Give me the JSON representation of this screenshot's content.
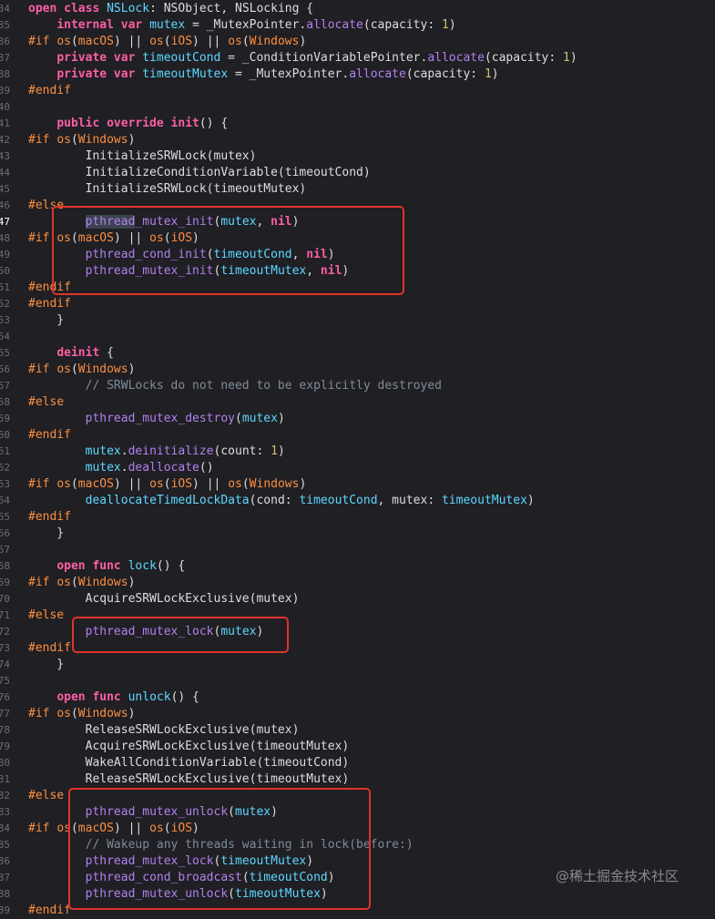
{
  "editor": {
    "lines": [
      {
        "n": "34",
        "segs": [
          [
            "kw",
            "open class "
          ],
          [
            "ty",
            "NSLock"
          ],
          [
            "pl",
            ": "
          ],
          [
            "pl",
            "NSObject"
          ],
          [
            "pl",
            ", "
          ],
          [
            "pl",
            "NSLocking"
          ],
          [
            "pl",
            " {"
          ]
        ]
      },
      {
        "n": "35",
        "segs": [
          [
            "pl",
            "    "
          ],
          [
            "kw",
            "internal var "
          ],
          [
            "ty",
            "mutex"
          ],
          [
            "pl",
            " = _MutexPointer."
          ],
          [
            "fn",
            "allocate"
          ],
          [
            "pl",
            "(capacity: "
          ],
          [
            "nu",
            "1"
          ],
          [
            "pl",
            ")"
          ]
        ]
      },
      {
        "n": "36",
        "segs": [
          [
            "pp",
            "#if "
          ],
          [
            "pp",
            "os"
          ],
          [
            "pl",
            "("
          ],
          [
            "pp",
            "macOS"
          ],
          [
            "pl",
            ") || "
          ],
          [
            "pp",
            "os"
          ],
          [
            "pl",
            "("
          ],
          [
            "pp",
            "iOS"
          ],
          [
            "pl",
            ") || "
          ],
          [
            "pp",
            "os"
          ],
          [
            "pl",
            "("
          ],
          [
            "pp",
            "Windows"
          ],
          [
            "pl",
            ")"
          ]
        ]
      },
      {
        "n": "37",
        "segs": [
          [
            "pl",
            "    "
          ],
          [
            "kw",
            "private var "
          ],
          [
            "ty",
            "timeoutCond"
          ],
          [
            "pl",
            " = _ConditionVariablePointer."
          ],
          [
            "fn",
            "allocate"
          ],
          [
            "pl",
            "(capacity: "
          ],
          [
            "nu",
            "1"
          ],
          [
            "pl",
            ")"
          ]
        ]
      },
      {
        "n": "38",
        "segs": [
          [
            "pl",
            "    "
          ],
          [
            "kw",
            "private var "
          ],
          [
            "ty",
            "timeoutMutex"
          ],
          [
            "pl",
            " = _MutexPointer."
          ],
          [
            "fn",
            "allocate"
          ],
          [
            "pl",
            "(capacity: "
          ],
          [
            "nu",
            "1"
          ],
          [
            "pl",
            ")"
          ]
        ]
      },
      {
        "n": "39",
        "segs": [
          [
            "pp",
            "#endif"
          ]
        ]
      },
      {
        "n": "40",
        "segs": []
      },
      {
        "n": "41",
        "segs": [
          [
            "pl",
            "    "
          ],
          [
            "kw",
            "public override "
          ],
          [
            "kw",
            "init"
          ],
          [
            "pl",
            "() {"
          ]
        ]
      },
      {
        "n": "42",
        "segs": [
          [
            "pp",
            "#if "
          ],
          [
            "pp",
            "os"
          ],
          [
            "pl",
            "("
          ],
          [
            "pp",
            "Windows"
          ],
          [
            "pl",
            ")"
          ]
        ]
      },
      {
        "n": "43",
        "segs": [
          [
            "pl",
            "        InitializeSRWLock(mutex)"
          ]
        ]
      },
      {
        "n": "44",
        "segs": [
          [
            "pl",
            "        InitializeConditionVariable(timeoutCond)"
          ]
        ]
      },
      {
        "n": "45",
        "segs": [
          [
            "pl",
            "        InitializeSRWLock(timeoutMutex)"
          ]
        ]
      },
      {
        "n": "46",
        "segs": [
          [
            "pp",
            "#else"
          ]
        ]
      },
      {
        "n": "47",
        "cur": true,
        "segs": [
          [
            "pl",
            "        "
          ],
          [
            "fn hl",
            "pthread"
          ],
          [
            "fn",
            "_mutex_init"
          ],
          [
            "pl",
            "("
          ],
          [
            "ty",
            "mutex"
          ],
          [
            "pl",
            ", "
          ],
          [
            "kw",
            "nil"
          ],
          [
            "pl",
            ")"
          ]
        ]
      },
      {
        "n": "48",
        "segs": [
          [
            "pp",
            "#if "
          ],
          [
            "pp",
            "os"
          ],
          [
            "pl",
            "("
          ],
          [
            "pp",
            "macOS"
          ],
          [
            "pl",
            ") || "
          ],
          [
            "pp",
            "os"
          ],
          [
            "pl",
            "("
          ],
          [
            "pp",
            "iOS"
          ],
          [
            "pl",
            ")"
          ]
        ]
      },
      {
        "n": "49",
        "segs": [
          [
            "pl",
            "        "
          ],
          [
            "fn",
            "pthread_cond_init"
          ],
          [
            "pl",
            "("
          ],
          [
            "ty",
            "timeoutCond"
          ],
          [
            "pl",
            ", "
          ],
          [
            "kw",
            "nil"
          ],
          [
            "pl",
            ")"
          ]
        ]
      },
      {
        "n": "50",
        "segs": [
          [
            "pl",
            "        "
          ],
          [
            "fn",
            "pthread_mutex_init"
          ],
          [
            "pl",
            "("
          ],
          [
            "ty",
            "timeoutMutex"
          ],
          [
            "pl",
            ", "
          ],
          [
            "kw",
            "nil"
          ],
          [
            "pl",
            ")"
          ]
        ]
      },
      {
        "n": "51",
        "segs": [
          [
            "pp",
            "#endif"
          ]
        ]
      },
      {
        "n": "52",
        "segs": [
          [
            "pp",
            "#endif"
          ]
        ]
      },
      {
        "n": "53",
        "segs": [
          [
            "pl",
            "    }"
          ]
        ]
      },
      {
        "n": "54",
        "segs": []
      },
      {
        "n": "55",
        "segs": [
          [
            "pl",
            "    "
          ],
          [
            "kw",
            "deinit"
          ],
          [
            "pl",
            " {"
          ]
        ]
      },
      {
        "n": "56",
        "segs": [
          [
            "pp",
            "#if "
          ],
          [
            "pp",
            "os"
          ],
          [
            "pl",
            "("
          ],
          [
            "pp",
            "Windows"
          ],
          [
            "pl",
            ")"
          ]
        ]
      },
      {
        "n": "57",
        "segs": [
          [
            "cm",
            "        // SRWLocks do not need to be explicitly destroyed"
          ]
        ]
      },
      {
        "n": "58",
        "segs": [
          [
            "pp",
            "#else"
          ]
        ]
      },
      {
        "n": "59",
        "segs": [
          [
            "pl",
            "        "
          ],
          [
            "fn",
            "pthread_mutex_destroy"
          ],
          [
            "pl",
            "("
          ],
          [
            "ty",
            "mutex"
          ],
          [
            "pl",
            ")"
          ]
        ]
      },
      {
        "n": "60",
        "segs": [
          [
            "pp",
            "#endif"
          ]
        ]
      },
      {
        "n": "61",
        "segs": [
          [
            "pl",
            "        "
          ],
          [
            "ty",
            "mutex"
          ],
          [
            "pl",
            "."
          ],
          [
            "fn",
            "deinitialize"
          ],
          [
            "pl",
            "(count: "
          ],
          [
            "nu",
            "1"
          ],
          [
            "pl",
            ")"
          ]
        ]
      },
      {
        "n": "62",
        "segs": [
          [
            "pl",
            "        "
          ],
          [
            "ty",
            "mutex"
          ],
          [
            "pl",
            "."
          ],
          [
            "fn",
            "deallocate"
          ],
          [
            "pl",
            "()"
          ]
        ]
      },
      {
        "n": "63",
        "segs": [
          [
            "pp",
            "#if "
          ],
          [
            "pp",
            "os"
          ],
          [
            "pl",
            "("
          ],
          [
            "pp",
            "macOS"
          ],
          [
            "pl",
            ") || "
          ],
          [
            "pp",
            "os"
          ],
          [
            "pl",
            "("
          ],
          [
            "pp",
            "iOS"
          ],
          [
            "pl",
            ") || "
          ],
          [
            "pp",
            "os"
          ],
          [
            "pl",
            "("
          ],
          [
            "pp",
            "Windows"
          ],
          [
            "pl",
            ")"
          ]
        ]
      },
      {
        "n": "64",
        "segs": [
          [
            "pl",
            "        "
          ],
          [
            "ty",
            "deallocateTimedLockData"
          ],
          [
            "pl",
            "(cond: "
          ],
          [
            "ty",
            "timeoutCond"
          ],
          [
            "pl",
            ", mutex: "
          ],
          [
            "ty",
            "timeoutMutex"
          ],
          [
            "pl",
            ")"
          ]
        ]
      },
      {
        "n": "65",
        "segs": [
          [
            "pp",
            "#endif"
          ]
        ]
      },
      {
        "n": "66",
        "segs": [
          [
            "pl",
            "    }"
          ]
        ]
      },
      {
        "n": "67",
        "segs": []
      },
      {
        "n": "68",
        "segs": [
          [
            "pl",
            "    "
          ],
          [
            "kw",
            "open func "
          ],
          [
            "ty",
            "lock"
          ],
          [
            "pl",
            "() {"
          ]
        ]
      },
      {
        "n": "69",
        "segs": [
          [
            "pp",
            "#if "
          ],
          [
            "pp",
            "os"
          ],
          [
            "pl",
            "("
          ],
          [
            "pp",
            "Windows"
          ],
          [
            "pl",
            ")"
          ]
        ]
      },
      {
        "n": "70",
        "segs": [
          [
            "pl",
            "        AcquireSRWLockExclusive(mutex)"
          ]
        ]
      },
      {
        "n": "71",
        "segs": [
          [
            "pp",
            "#else"
          ]
        ]
      },
      {
        "n": "72",
        "segs": [
          [
            "pl",
            "        "
          ],
          [
            "fn",
            "pthread_mutex_lock"
          ],
          [
            "pl",
            "("
          ],
          [
            "ty",
            "mutex"
          ],
          [
            "pl",
            ")"
          ]
        ]
      },
      {
        "n": "73",
        "segs": [
          [
            "pp",
            "#endif"
          ]
        ]
      },
      {
        "n": "74",
        "segs": [
          [
            "pl",
            "    }"
          ]
        ]
      },
      {
        "n": "75",
        "segs": []
      },
      {
        "n": "76",
        "segs": [
          [
            "pl",
            "    "
          ],
          [
            "kw",
            "open func "
          ],
          [
            "ty",
            "unlock"
          ],
          [
            "pl",
            "() {"
          ]
        ]
      },
      {
        "n": "77",
        "segs": [
          [
            "pp",
            "#if "
          ],
          [
            "pp",
            "os"
          ],
          [
            "pl",
            "("
          ],
          [
            "pp",
            "Windows"
          ],
          [
            "pl",
            ")"
          ]
        ]
      },
      {
        "n": "78",
        "segs": [
          [
            "pl",
            "        ReleaseSRWLockExclusive(mutex)"
          ]
        ]
      },
      {
        "n": "79",
        "segs": [
          [
            "pl",
            "        AcquireSRWLockExclusive(timeoutMutex)"
          ]
        ]
      },
      {
        "n": "80",
        "segs": [
          [
            "pl",
            "        WakeAllConditionVariable(timeoutCond)"
          ]
        ]
      },
      {
        "n": "81",
        "segs": [
          [
            "pl",
            "        ReleaseSRWLockExclusive(timeoutMutex)"
          ]
        ]
      },
      {
        "n": "82",
        "segs": [
          [
            "pp",
            "#else"
          ]
        ]
      },
      {
        "n": "83",
        "segs": [
          [
            "pl",
            "        "
          ],
          [
            "fn",
            "pthread_mutex_unlock"
          ],
          [
            "pl",
            "("
          ],
          [
            "ty",
            "mutex"
          ],
          [
            "pl",
            ")"
          ]
        ]
      },
      {
        "n": "84",
        "segs": [
          [
            "pp",
            "#if "
          ],
          [
            "pp",
            "os"
          ],
          [
            "pl",
            "("
          ],
          [
            "pp",
            "macOS"
          ],
          [
            "pl",
            ") || "
          ],
          [
            "pp",
            "os"
          ],
          [
            "pl",
            "("
          ],
          [
            "pp",
            "iOS"
          ],
          [
            "pl",
            ")"
          ]
        ]
      },
      {
        "n": "85",
        "segs": [
          [
            "cm",
            "        // Wakeup any threads waiting in lock(before:)"
          ]
        ]
      },
      {
        "n": "86",
        "segs": [
          [
            "pl",
            "        "
          ],
          [
            "fn",
            "pthread_mutex_lock"
          ],
          [
            "pl",
            "("
          ],
          [
            "ty",
            "timeoutMutex"
          ],
          [
            "pl",
            ")"
          ]
        ]
      },
      {
        "n": "87",
        "segs": [
          [
            "pl",
            "        "
          ],
          [
            "fn",
            "pthread_cond_broadcast"
          ],
          [
            "pl",
            "("
          ],
          [
            "ty",
            "timeoutCond"
          ],
          [
            "pl",
            ")"
          ]
        ]
      },
      {
        "n": "88",
        "segs": [
          [
            "pl",
            "        "
          ],
          [
            "fn",
            "pthread_mutex_unlock"
          ],
          [
            "pl",
            "("
          ],
          [
            "ty",
            "timeoutMutex"
          ],
          [
            "pl",
            ")"
          ]
        ]
      },
      {
        "n": "89",
        "segs": [
          [
            "pp",
            "#endif"
          ]
        ]
      }
    ]
  },
  "watermark": "@稀土掘金技术社区",
  "colors": {
    "background": "#1f1f24",
    "keyword": "#fc5fa3",
    "preprocessor": "#fd8f3f",
    "function": "#b281eb",
    "identifier": "#5dd8ff",
    "number": "#d0bf69",
    "comment": "#7f8c98",
    "annotation_box": "#e0342a"
  }
}
